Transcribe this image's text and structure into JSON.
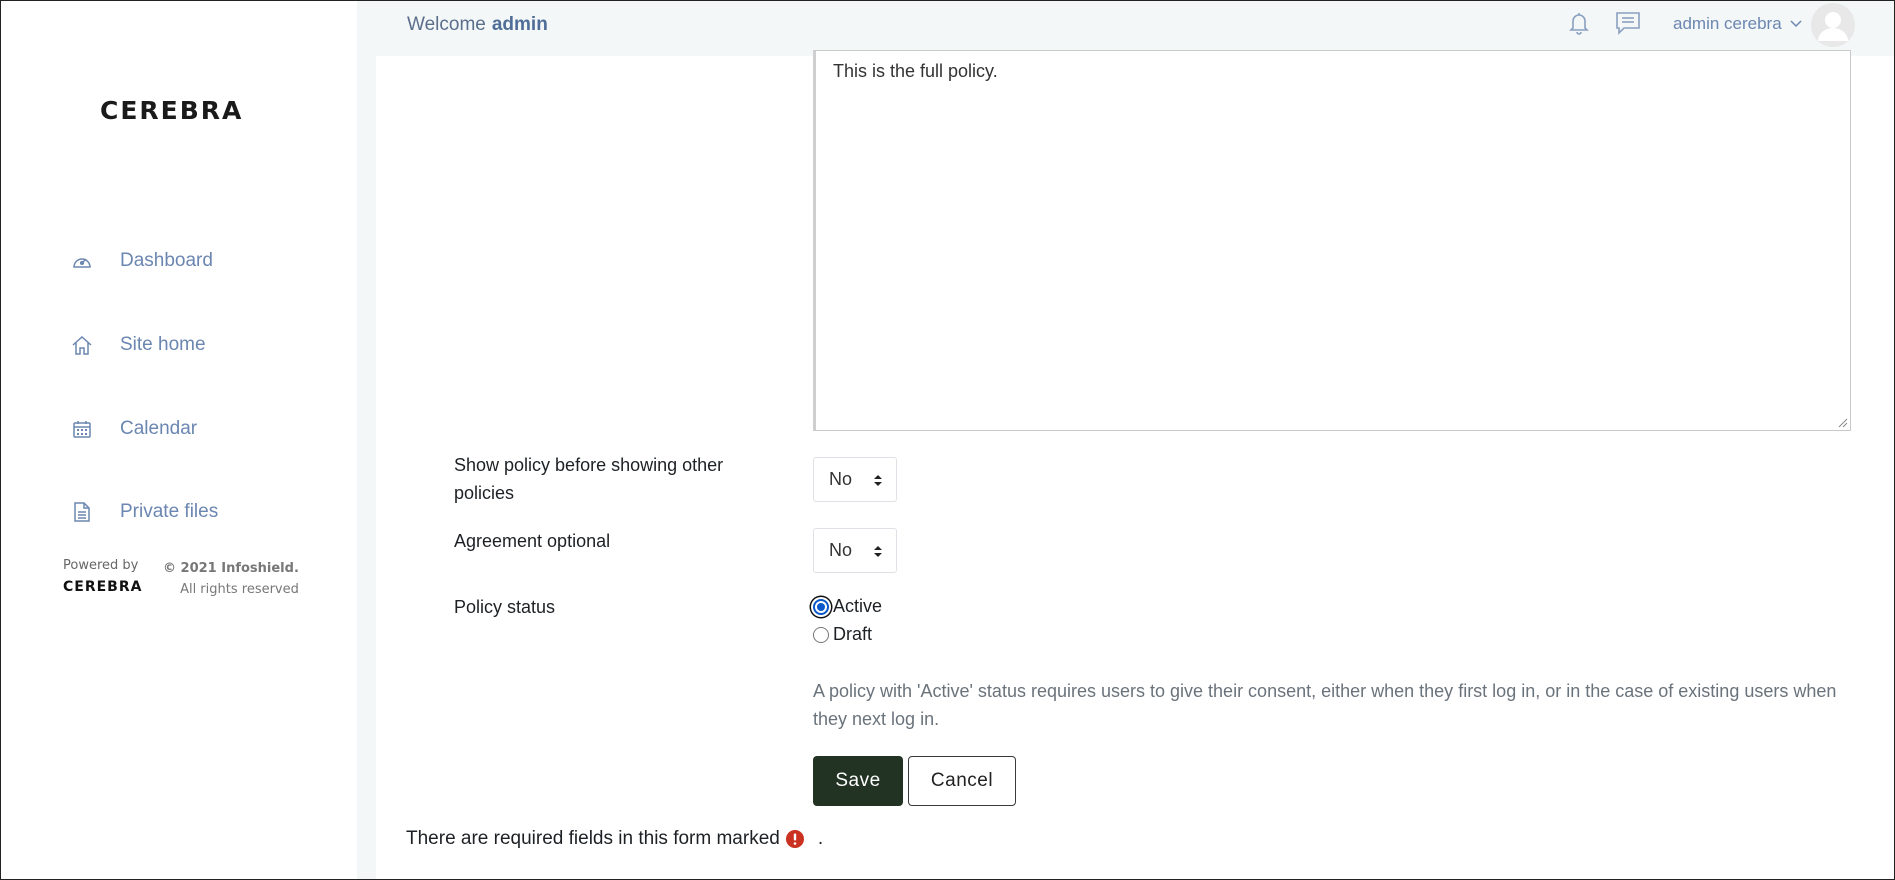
{
  "header": {
    "welcome_label": "Welcome",
    "welcome_name": "admin",
    "user_menu_label": "admin cerebra"
  },
  "sidebar": {
    "logo": "CEREBRA",
    "items": [
      {
        "label": "Dashboard",
        "icon": "gauge-icon"
      },
      {
        "label": "Site home",
        "icon": "home-icon"
      },
      {
        "label": "Calendar",
        "icon": "calendar-icon"
      },
      {
        "label": "Private files",
        "icon": "file-icon"
      }
    ],
    "powered_by": "Powered by",
    "powered_brand": "CEREBRA",
    "copyright_line1": "© 2021 Infoshield.",
    "copyright_line2": "All rights reserved"
  },
  "form": {
    "editor_text": "This is the full policy.",
    "show_policy_label": "Show policy before showing other policies",
    "show_policy_value": "No",
    "agreement_optional_label": "Agreement optional",
    "agreement_optional_value": "No",
    "policy_status_label": "Policy status",
    "status_options": [
      {
        "label": "Active",
        "checked": true
      },
      {
        "label": "Draft",
        "checked": false
      }
    ],
    "status_help": "A policy with 'Active' status requires users to give their consent, either when they first log in, or in the case of existing users when they next log in.",
    "save_label": "Save",
    "cancel_label": "Cancel",
    "required_note": "There are required fields in this form marked",
    "required_note_end": "."
  },
  "colors": {
    "accent": "#6b86b0",
    "save_button": "#223223",
    "required_icon": "#ca3120",
    "radio_checked": "#0a58ca"
  }
}
